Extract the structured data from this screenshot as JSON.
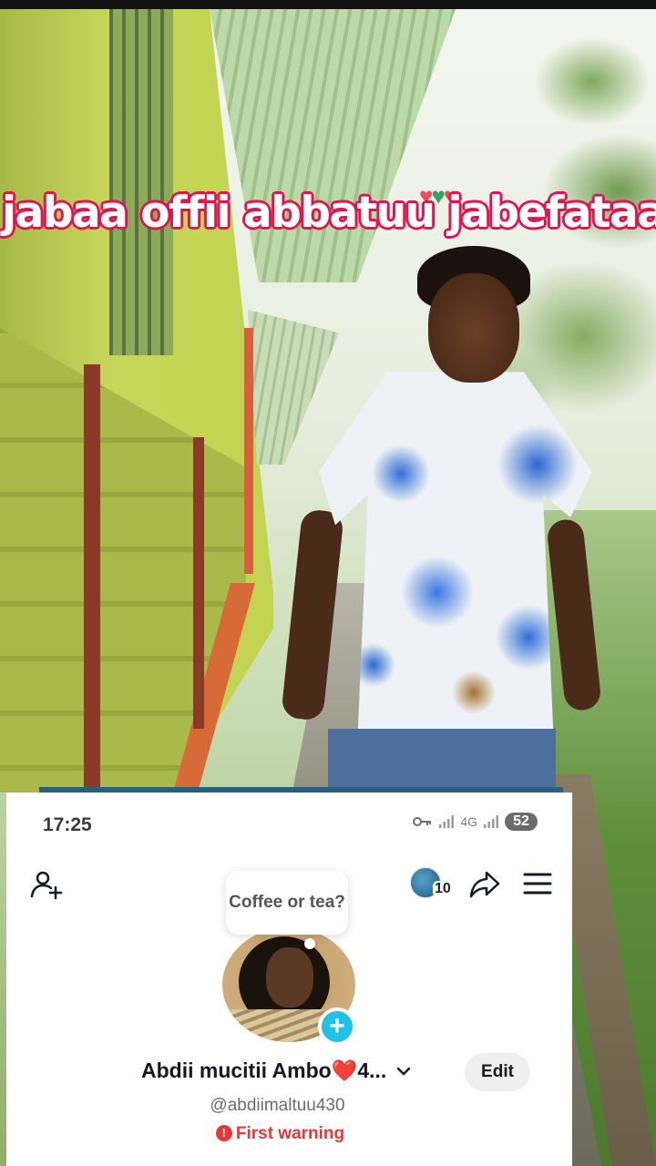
{
  "caption": {
    "text": "jabaa offii abbatuu jabefataa",
    "hearts": [
      "♥",
      "♥",
      "♥"
    ],
    "text_color": "#ffffff",
    "outline_color": "#e0154f"
  },
  "status_bar": {
    "time": "17:25",
    "network_label": "4G",
    "battery": "52"
  },
  "profile_header": {
    "viewer_count": "10",
    "icons": [
      "add-friend-icon",
      "share-icon",
      "menu-icon"
    ]
  },
  "profile": {
    "bubble_text": "Coffee or tea?",
    "display_name": "Abdii mucitii Ambo❤️4...",
    "edit_label": "Edit",
    "handle": "@abdiimaltuu430",
    "warning": "First warning"
  },
  "colors": {
    "accent": "#20c1e6",
    "warning": "#e5383b",
    "edit_bg": "#efefef"
  }
}
